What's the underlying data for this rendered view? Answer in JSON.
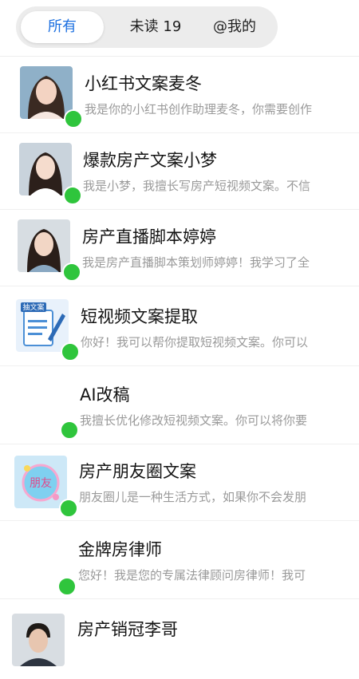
{
  "tabs": [
    {
      "label": "所有",
      "active": true
    },
    {
      "label": "未读 19",
      "active": false
    },
    {
      "label": "@我的",
      "active": false
    }
  ],
  "colors": {
    "accent": "#1b6fe0",
    "online": "#2fc53c",
    "muted": "#9a9a9a"
  },
  "chats": [
    {
      "name": "小红书文案麦冬",
      "preview": "我是你的小红书创作助理麦冬，你需要创作",
      "avatar": "woman-portrait",
      "online": true
    },
    {
      "name": "爆款房产文案小梦",
      "preview": "我是小梦，我擅长写房产短视频文案。不信",
      "avatar": "woman-portrait",
      "online": true
    },
    {
      "name": "房产直播脚本婷婷",
      "preview": "我是房产直播脚本策划师婷婷！我学习了全",
      "avatar": "woman-portrait",
      "online": true
    },
    {
      "name": "短视频文案提取",
      "preview": "你好！我可以帮你提取短视频文案。你可以",
      "avatar": "document-pen",
      "avatar_text": "抽文案",
      "online": true
    },
    {
      "name": "AI改稿",
      "preview": "我擅长优化修改短视频文案。你可以将你要",
      "avatar": "none",
      "online": true
    },
    {
      "name": "房产朋友圈文案",
      "preview": "朋友圈儿是一种生活方式，如果你不会发朋",
      "avatar": "friends-badge",
      "avatar_text": "朋友",
      "online": true
    },
    {
      "name": "金牌房律师",
      "preview": "您好！我是您的专属法律顾问房律师！我可",
      "avatar": "none",
      "online": true
    },
    {
      "name": "房产销冠李哥",
      "preview": "",
      "avatar": "man-portrait",
      "online": false
    }
  ]
}
